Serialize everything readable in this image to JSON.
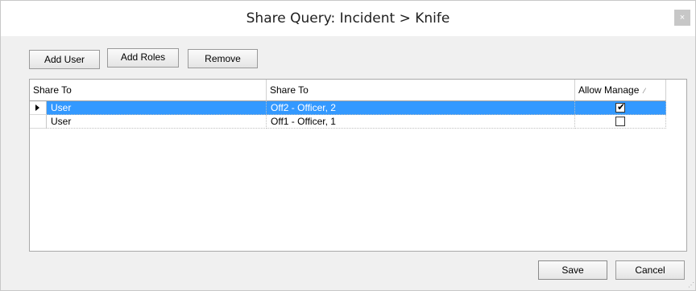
{
  "window": {
    "title": "Share Query: Incident > Knife",
    "close_label": "×"
  },
  "toolbar": {
    "add_user": "Add User",
    "add_roles": "Add Roles",
    "remove": "Remove"
  },
  "grid": {
    "columns": [
      "Share To",
      "Share To",
      "Allow Manage"
    ],
    "rows": [
      {
        "type": "User",
        "share_to": "Off2 - Officer, 2",
        "allow_manage": true,
        "selected": true
      },
      {
        "type": "User",
        "share_to": "Off1 - Officer, 1",
        "allow_manage": false,
        "selected": false
      }
    ]
  },
  "footer": {
    "save": "Save",
    "cancel": "Cancel"
  },
  "colors": {
    "selection": "#3399ff",
    "dialog_bg": "#f0f0f0"
  },
  "icons": {
    "close": "close-icon",
    "row_indicator": "triangle-right-icon",
    "sort": "sort-indicator-icon",
    "grip": "resize-grip-icon"
  }
}
